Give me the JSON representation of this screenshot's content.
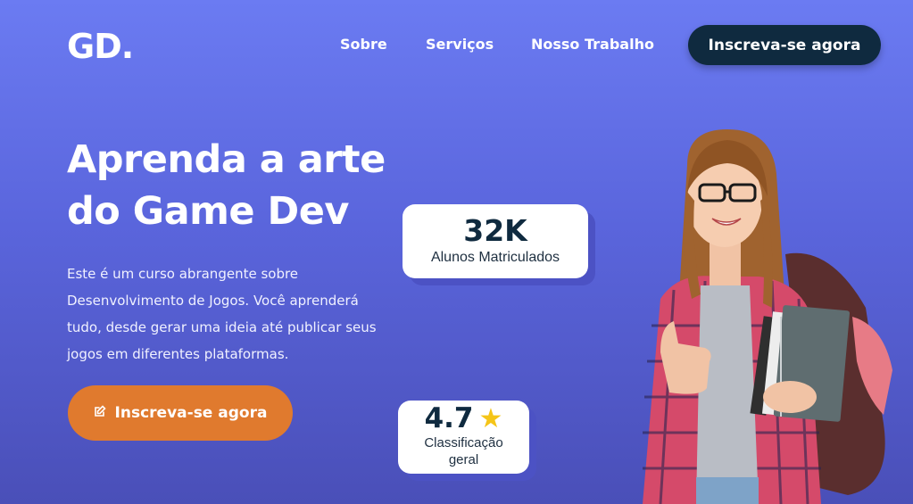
{
  "brand": {
    "logo": "GD."
  },
  "nav": {
    "items": [
      "Sobre",
      "Serviços",
      "Nosso Trabalho"
    ],
    "cta": "Inscreva-se agora"
  },
  "hero": {
    "title_line1": "Aprenda a arte",
    "title_line2": "do Game Dev",
    "description": "Este é um curso abrangente sobre Desenvolvimento de Jogos. Você aprenderá tudo, desde gerar uma ideia até publicar seus jogos em diferentes plataformas.",
    "cta": "Inscreva-se agora"
  },
  "stats": {
    "students": {
      "value": "32K",
      "label": "Alunos Matriculados"
    },
    "rating": {
      "value": "4.7",
      "label_line1": "Classificação",
      "label_line2": "geral",
      "icon": "star-icon"
    }
  },
  "colors": {
    "accent": "#e07a2e",
    "navy": "#0f2a3f",
    "background_top": "#6b7bf2",
    "background_bottom": "#4a4fb8",
    "star": "#f5c518"
  }
}
